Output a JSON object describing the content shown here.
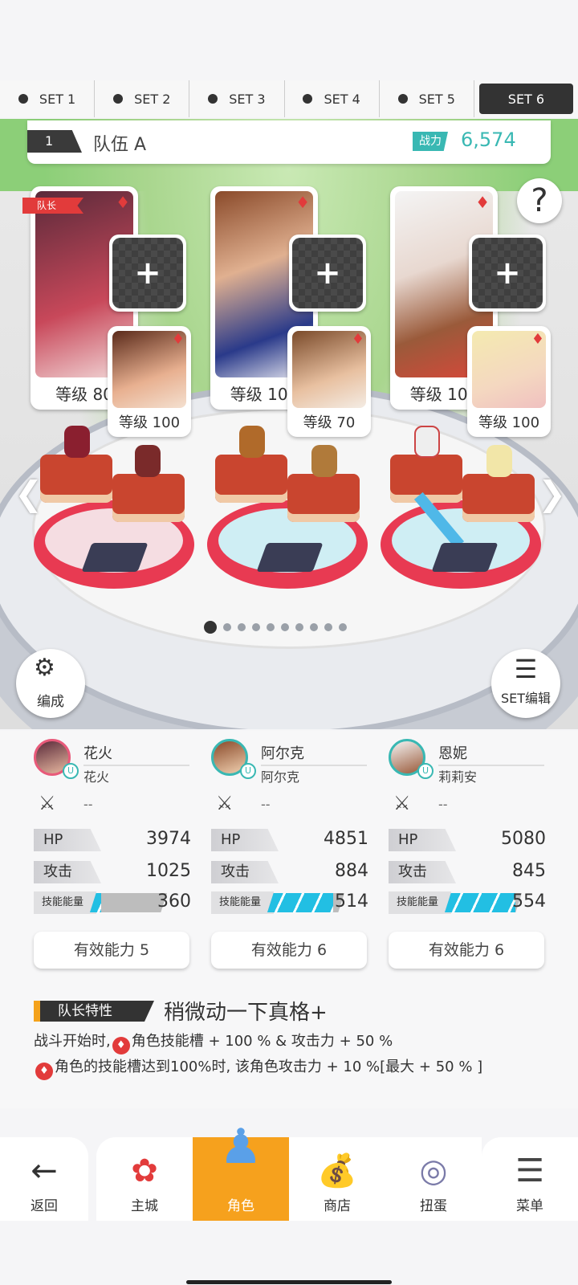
{
  "sets": [
    {
      "label": "SET 1",
      "active": false
    },
    {
      "label": "SET 2",
      "active": false
    },
    {
      "label": "SET 3",
      "active": false
    },
    {
      "label": "SET 4",
      "active": false
    },
    {
      "label": "SET 5",
      "active": false
    },
    {
      "label": "SET 6",
      "active": true
    }
  ],
  "team": {
    "number": "1",
    "name": "队伍 A",
    "power_label": "战力",
    "power": "6,574"
  },
  "leader_tag": "队长",
  "help_label": "?",
  "main_cards": [
    {
      "level": "等级 80",
      "suit": "♦"
    },
    {
      "level": "等级 100",
      "suit": "♦"
    },
    {
      "level": "等级 100",
      "suit": "♦"
    }
  ],
  "sub_cards": [
    {
      "level": "等级 100",
      "suit": "♦"
    },
    {
      "level": "等级 70",
      "suit": "♦"
    },
    {
      "level": "等级 100",
      "suit": "♦"
    }
  ],
  "page_dots": 10,
  "page_active": 0,
  "buttons": {
    "formation": "编成",
    "set_edit": "SET编辑"
  },
  "characters": [
    {
      "name": "花火",
      "sub": "花火",
      "weapon": "--",
      "hp_label": "HP",
      "hp": "3974",
      "atk_label": "攻击",
      "atk": "1025",
      "energy_label": "技能能量",
      "energy": "360",
      "energy_fill": 0.15,
      "effective": "有效能力 5"
    },
    {
      "name": "阿尔克",
      "sub": "阿尔克",
      "weapon": "--",
      "hp_label": "HP",
      "hp": "4851",
      "atk_label": "攻击",
      "atk": "884",
      "energy_label": "技能能量",
      "energy": "514",
      "energy_fill": 0.85,
      "effective": "有效能力 6"
    },
    {
      "name": "恩妮",
      "sub": "莉莉安",
      "weapon": "--",
      "hp_label": "HP",
      "hp": "5080",
      "atk_label": "攻击",
      "atk": "845",
      "energy_label": "技能能量",
      "energy": "554",
      "energy_fill": 0.92,
      "effective": "有效能力 6"
    }
  ],
  "leader_skill": {
    "tag": "队长特性",
    "title": "稍微动一下真格+",
    "line1_pre": "战斗开始时,",
    "line1_post": "角色技能槽 + 100 % & 攻击力 + 50 %",
    "line2_post": "角色的技能槽达到100%时, 该角色攻击力 + 10 %[最大 + 50 % ]"
  },
  "nav": [
    {
      "label": "返回",
      "icon": "back-arrow-icon"
    },
    {
      "label": "主城",
      "icon": "castle-icon"
    },
    {
      "label": "角色",
      "icon": "character-icon",
      "active": true
    },
    {
      "label": "商店",
      "icon": "shop-icon"
    },
    {
      "label": "扭蛋",
      "icon": "gacha-icon"
    },
    {
      "label": "菜单",
      "icon": "menu-icon"
    }
  ]
}
